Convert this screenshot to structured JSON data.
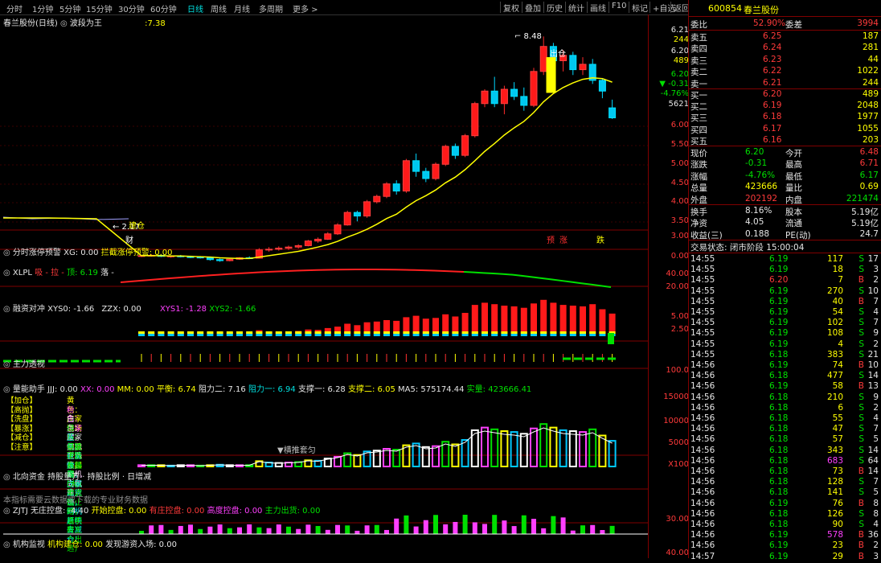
{
  "toolbar": {
    "periods": [
      "分时",
      "1分钟",
      "5分钟",
      "15分钟",
      "30分钟",
      "60分钟",
      "日线",
      "周线",
      "月线",
      "多周期",
      "更多 >"
    ],
    "active_period": "日线",
    "buttons": [
      "复权",
      "叠加",
      "历史",
      "统计",
      "画线",
      "F10",
      "标记",
      "+自选",
      "返回"
    ]
  },
  "main_pane": {
    "title": "春兰股份(日线)",
    "indicator": "波段为王",
    "indicator_value": ":7.38",
    "high_label": "8.48",
    "low_label": "2.17",
    "signal_chucang": "出仓",
    "signal_jiancang": "建仓",
    "marker_cai": "财",
    "markers_bottom": [
      "预",
      "涨",
      "跌"
    ],
    "axis": {
      "price_top": "6.21",
      "vol_top": "244",
      "price_mid": "6.20",
      "vol_mid": "489",
      "last": "6.20",
      "change": "▼ -0.31",
      "pct": "-4.76%",
      "volume": "5621",
      "ticks": [
        "6.00",
        "5.50",
        "5.00",
        "4.50",
        "4.00",
        "3.50",
        "3.00"
      ]
    }
  },
  "pane_xg": {
    "title": "分时涨停预警",
    "text": "XG: 0.00",
    "extra": "拦截涨停预警: 0.00",
    "axis": [
      "0.00"
    ]
  },
  "pane_xlpl": {
    "title": "XLPL",
    "items": [
      "吸 -",
      "拉 -",
      "顶: 6.19",
      "落 -"
    ],
    "axis": [
      "40.00",
      "20.00"
    ]
  },
  "pane_rongzi": {
    "title": "融资对冲",
    "items": [
      "XYS0: -1.66",
      "ZZX: 0.00",
      "XYS1: -1.28",
      "XYS2: -1.66"
    ],
    "axis": [
      "5.00",
      "2.50"
    ]
  },
  "pane_zhuli": {
    "title": "主力透视",
    "axis": [
      "100.0"
    ]
  },
  "pane_liangneng": {
    "title": "量能助手",
    "items": [
      "JJJ: 0.00",
      "XX: 0.00",
      "MM: 0.00",
      "平衡: 6.74",
      "阻力二: 7.16",
      "阻力一: 6.94",
      "支撑一: 6.28",
      "支撑二: 6.05",
      "MA5: 575174.44",
      "实量: 423666.41"
    ],
    "legend": [
      {
        "tag": "【加仓】",
        "text": "黄色：庄家进场缓，伺机进场等起飞"
      },
      {
        "tag": "【高抛】",
        "text": "粉色：庄家忙，高抛低吸，伺机去做差"
      },
      {
        "tag": "【洗盘】",
        "text": "白色：庄家抗震在洗盘，伺机向机建点仓"
      },
      {
        "tag": "【暴涨】",
        "text": "绿色：暴跌破，高场景，比面力，等止跌，暴手房！"
      },
      {
        "tag": "【减仓】",
        "text": "蓝色：巨量悖离，庄家出货流，伺机赶快去减仓！"
      },
      {
        "tag": "【注意】",
        "text": "巨量下跌有量缩(大单流出时，说明有主力出逃)"
      }
    ],
    "annotation": "▼横推套匀",
    "axis": [
      "15000",
      "10000",
      "5000"
    ],
    "scale": "X100"
  },
  "pane_beixiang": {
    "title": "北向资金",
    "text": "持股量万 · 持股比例 · 日增减",
    "note": "本指标需要云数据或下载的专业财务数据"
  },
  "pane_zjtj": {
    "title": "ZJTJ",
    "items": [
      "无庄控盘: -4.40",
      "开始控盘: 0.00",
      "有庄控盘: 0.00",
      "高度控盘: 0.00",
      "主力出货: 0.00"
    ],
    "axis": [
      "30.00"
    ]
  },
  "pane_jigou": {
    "title": "机构监视",
    "items": [
      "机构建仓: 0.00",
      "发现游资入场: 0.00"
    ],
    "axis": [
      "40.00"
    ]
  },
  "quote": {
    "code": "600854",
    "name": "春兰股份",
    "weibi_label": "委比",
    "weibi": "52.90%",
    "weicha_label": "委差",
    "weicha": "3994",
    "sell": [
      {
        "label": "卖五",
        "price": "6.25",
        "vol": "187"
      },
      {
        "label": "卖四",
        "price": "6.24",
        "vol": "281"
      },
      {
        "label": "卖三",
        "price": "6.23",
        "vol": "44"
      },
      {
        "label": "卖二",
        "price": "6.22",
        "vol": "1022"
      },
      {
        "label": "卖一",
        "price": "6.21",
        "vol": "244"
      }
    ],
    "buy": [
      {
        "label": "买一",
        "price": "6.20",
        "vol": "489"
      },
      {
        "label": "买二",
        "price": "6.19",
        "vol": "2048"
      },
      {
        "label": "买三",
        "price": "6.18",
        "vol": "1977"
      },
      {
        "label": "买四",
        "price": "6.17",
        "vol": "1055"
      },
      {
        "label": "买五",
        "price": "6.16",
        "vol": "203"
      }
    ],
    "stats": [
      {
        "l1": "现价",
        "v1": "6.20",
        "c1": "green",
        "l2": "今开",
        "v2": "6.48",
        "c2": "red"
      },
      {
        "l1": "涨跌",
        "v1": "-0.31",
        "c1": "green",
        "l2": "最高",
        "v2": "6.71",
        "c2": "red"
      },
      {
        "l1": "涨幅",
        "v1": "-4.76%",
        "c1": "green",
        "l2": "最低",
        "v2": "6.17",
        "c2": "green"
      },
      {
        "l1": "总量",
        "v1": "423666",
        "c1": "yellow",
        "l2": "量比",
        "v2": "0.69",
        "c2": "yellow"
      },
      {
        "l1": "外盘",
        "v1": "202192",
        "c1": "red",
        "l2": "内盘",
        "v2": "221474",
        "c2": "green"
      }
    ],
    "stats2": [
      {
        "l1": "换手",
        "v1": "8.16%",
        "l2": "股本",
        "v2": "5.19亿"
      },
      {
        "l1": "净资",
        "v1": "4.05",
        "l2": "流通",
        "v2": "5.19亿"
      },
      {
        "l1": "收益(三)",
        "v1": "0.188",
        "l2": "PE(动)",
        "v2": "24.7"
      }
    ],
    "status": "交易状态: 闭市阶段 15:00:04"
  },
  "ticks": [
    {
      "t": "14:55",
      "p": "6.19",
      "v": "117",
      "d": "S",
      "n": "17"
    },
    {
      "t": "14:55",
      "p": "6.19",
      "v": "18",
      "d": "S",
      "n": "3"
    },
    {
      "t": "14:55",
      "p": "6.20",
      "v": "7",
      "d": "B",
      "n": "2"
    },
    {
      "t": "14:55",
      "p": "6.19",
      "v": "270",
      "d": "S",
      "n": "10"
    },
    {
      "t": "14:55",
      "p": "6.19",
      "v": "40",
      "d": "B",
      "n": "7"
    },
    {
      "t": "14:55",
      "p": "6.19",
      "v": "54",
      "d": "S",
      "n": "4"
    },
    {
      "t": "14:55",
      "p": "6.19",
      "v": "102",
      "d": "S",
      "n": "7"
    },
    {
      "t": "14:55",
      "p": "6.19",
      "v": "108",
      "d": "S",
      "n": "9"
    },
    {
      "t": "14:55",
      "p": "6.19",
      "v": "4",
      "d": "S",
      "n": "2"
    },
    {
      "t": "14:55",
      "p": "6.18",
      "v": "383",
      "d": "S",
      "n": "21"
    },
    {
      "t": "14:56",
      "p": "6.19",
      "v": "74",
      "d": "B",
      "n": "10"
    },
    {
      "t": "14:56",
      "p": "6.18",
      "v": "477",
      "d": "S",
      "n": "14"
    },
    {
      "t": "14:56",
      "p": "6.19",
      "v": "58",
      "d": "B",
      "n": "13"
    },
    {
      "t": "14:56",
      "p": "6.18",
      "v": "210",
      "d": "S",
      "n": "9"
    },
    {
      "t": "14:56",
      "p": "6.18",
      "v": "6",
      "d": "S",
      "n": "2"
    },
    {
      "t": "14:56",
      "p": "6.18",
      "v": "55",
      "d": "S",
      "n": "4"
    },
    {
      "t": "14:56",
      "p": "6.18",
      "v": "47",
      "d": "S",
      "n": "7"
    },
    {
      "t": "14:56",
      "p": "6.18",
      "v": "57",
      "d": "S",
      "n": "5"
    },
    {
      "t": "14:56",
      "p": "6.18",
      "v": "343",
      "d": "S",
      "n": "14"
    },
    {
      "t": "14:56",
      "p": "6.18",
      "v": "683",
      "d": "S",
      "n": "64"
    },
    {
      "t": "14:56",
      "p": "6.18",
      "v": "73",
      "d": "B",
      "n": "14"
    },
    {
      "t": "14:56",
      "p": "6.18",
      "v": "128",
      "d": "S",
      "n": "7"
    },
    {
      "t": "14:56",
      "p": "6.18",
      "v": "141",
      "d": "S",
      "n": "5"
    },
    {
      "t": "14:56",
      "p": "6.19",
      "v": "76",
      "d": "B",
      "n": "8"
    },
    {
      "t": "14:56",
      "p": "6.18",
      "v": "126",
      "d": "S",
      "n": "8"
    },
    {
      "t": "14:56",
      "p": "6.18",
      "v": "90",
      "d": "S",
      "n": "4"
    },
    {
      "t": "14:56",
      "p": "6.19",
      "v": "578",
      "d": "B",
      "n": "36"
    },
    {
      "t": "14:56",
      "p": "6.19",
      "v": "23",
      "d": "B",
      "n": "2"
    },
    {
      "t": "14:57",
      "p": "6.19",
      "v": "29",
      "d": "B",
      "n": "3"
    }
  ],
  "chart_data": {
    "type": "candlestick",
    "series": [
      {
        "values": [
          [
            2.33,
            2.36,
            2.3,
            2.34
          ],
          [
            2.34,
            2.38,
            2.31,
            2.35
          ],
          [
            2.35,
            2.37,
            2.3,
            2.32
          ],
          [
            2.32,
            2.35,
            2.28,
            2.33
          ],
          [
            2.33,
            2.36,
            2.29,
            2.31
          ],
          [
            2.31,
            2.34,
            2.27,
            2.3
          ],
          [
            2.3,
            2.33,
            2.26,
            2.28
          ],
          [
            2.28,
            2.31,
            2.2,
            2.23
          ],
          [
            2.23,
            2.26,
            2.17,
            2.2
          ],
          [
            2.2,
            2.25,
            2.18,
            2.24
          ],
          [
            2.24,
            2.3,
            2.22,
            2.28
          ],
          [
            2.28,
            2.32,
            2.25,
            2.27
          ],
          [
            2.27,
            2.55,
            2.26,
            2.5
          ],
          [
            2.5,
            2.58,
            2.45,
            2.52
          ],
          [
            2.52,
            2.6,
            2.48,
            2.55
          ],
          [
            2.55,
            2.62,
            2.5,
            2.58
          ],
          [
            2.58,
            2.66,
            2.54,
            2.62
          ],
          [
            2.62,
            2.78,
            2.6,
            2.75
          ],
          [
            2.75,
            2.85,
            2.7,
            2.8
          ],
          [
            2.8,
            3.0,
            2.78,
            2.95
          ],
          [
            2.95,
            3.25,
            2.92,
            3.2
          ],
          [
            3.2,
            3.6,
            3.18,
            3.55
          ],
          [
            3.55,
            3.6,
            3.3,
            3.45
          ],
          [
            3.45,
            3.9,
            3.4,
            3.85
          ],
          [
            3.85,
            4.05,
            3.8,
            4.0
          ],
          [
            4.0,
            4.4,
            3.95,
            4.35
          ],
          [
            4.35,
            4.45,
            4.05,
            4.15
          ],
          [
            4.15,
            5.05,
            4.1,
            5.0
          ],
          [
            5.0,
            5.2,
            4.55,
            4.7
          ],
          [
            4.7,
            4.8,
            4.4,
            4.5
          ],
          [
            4.5,
            4.95,
            4.45,
            4.9
          ],
          [
            4.9,
            5.45,
            4.85,
            5.4
          ],
          [
            5.4,
            5.48,
            5.05,
            5.15
          ],
          [
            5.15,
            5.75,
            5.1,
            5.7
          ],
          [
            5.7,
            6.65,
            5.65,
            6.6
          ],
          [
            6.6,
            7.0,
            6.5,
            6.95
          ],
          [
            6.95,
            7.35,
            6.5,
            6.6
          ],
          [
            6.6,
            7.1,
            6.3,
            7.0
          ],
          [
            7.0,
            7.2,
            6.7,
            6.8
          ],
          [
            6.8,
            7.05,
            6.4,
            6.55
          ],
          [
            6.55,
            7.6,
            6.5,
            7.5
          ],
          [
            7.5,
            8.48,
            7.4,
            8.2
          ],
          [
            8.2,
            8.3,
            7.6,
            7.8
          ],
          [
            7.8,
            8.1,
            7.5,
            7.95
          ],
          [
            7.95,
            8.05,
            7.4,
            7.55
          ],
          [
            7.55,
            7.9,
            7.4,
            7.7
          ],
          [
            7.7,
            7.85,
            7.15,
            7.25
          ],
          [
            7.25,
            7.3,
            6.75,
            6.95
          ],
          [
            6.48,
            6.71,
            6.17,
            6.2
          ]
        ]
      }
    ],
    "ma": [
      2.34,
      2.34,
      2.34,
      2.33,
      2.33,
      2.32,
      2.31,
      2.3,
      2.28,
      2.27,
      2.26,
      2.26,
      2.3,
      2.34,
      2.38,
      2.42,
      2.46,
      2.52,
      2.58,
      2.65,
      2.74,
      2.86,
      2.96,
      3.08,
      3.22,
      3.38,
      3.5,
      3.7,
      3.88,
      4.02,
      4.18,
      4.38,
      4.54,
      4.75,
      5.0,
      5.26,
      5.48,
      5.72,
      5.92,
      6.1,
      6.35,
      6.65,
      6.88,
      7.05,
      7.18,
      7.28,
      7.32,
      7.3,
      7.2
    ],
    "volume": [
      3,
      3,
      3,
      2,
      3,
      3,
      2,
      3,
      4,
      3,
      3,
      3,
      12,
      9,
      8,
      9,
      10,
      14,
      13,
      18,
      22,
      30,
      26,
      34,
      36,
      40,
      38,
      48,
      52,
      44,
      46,
      56,
      50,
      60,
      82,
      88,
      84,
      80,
      78,
      74,
      86,
      96,
      88,
      82,
      80,
      78,
      84,
      70,
      58
    ],
    "ylim": [
      2.9,
      8.6
    ]
  }
}
